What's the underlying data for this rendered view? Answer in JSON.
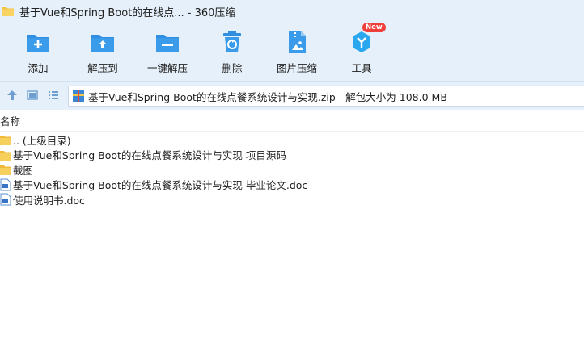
{
  "window": {
    "title": "基于Vue和Spring Boot的在线点... - 360压缩"
  },
  "toolbar": {
    "items": [
      {
        "label": "添加",
        "icon": "add-icon"
      },
      {
        "label": "解压到",
        "icon": "extract-to-icon"
      },
      {
        "label": "一键解压",
        "icon": "one-click-extract-icon"
      },
      {
        "label": "删除",
        "icon": "delete-icon"
      },
      {
        "label": "图片压缩",
        "icon": "image-compress-icon"
      },
      {
        "label": "工具",
        "icon": "tools-icon",
        "badge": "New"
      }
    ]
  },
  "address": {
    "path": "基于Vue和Spring Boot的在线点餐系统设计与实现.zip - 解包大小为 108.0 MB"
  },
  "columns": {
    "name": "名称"
  },
  "files": [
    {
      "name": ".. (上级目录)",
      "type": "folder"
    },
    {
      "name": "基于Vue和Spring Boot的在线点餐系统设计与实现 项目源码",
      "type": "folder"
    },
    {
      "name": "截图",
      "type": "folder"
    },
    {
      "name": "基于Vue和Spring Boot的在线点餐系统设计与实现 毕业论文.doc",
      "type": "doc"
    },
    {
      "name": "使用说明书.doc",
      "type": "doc"
    }
  ],
  "colors": {
    "toolbar_bg": "#e6f0fa",
    "icon_blue": "#2f8ee0",
    "badge_red": "#f0403a",
    "folder_yellow": "#f5c544"
  }
}
